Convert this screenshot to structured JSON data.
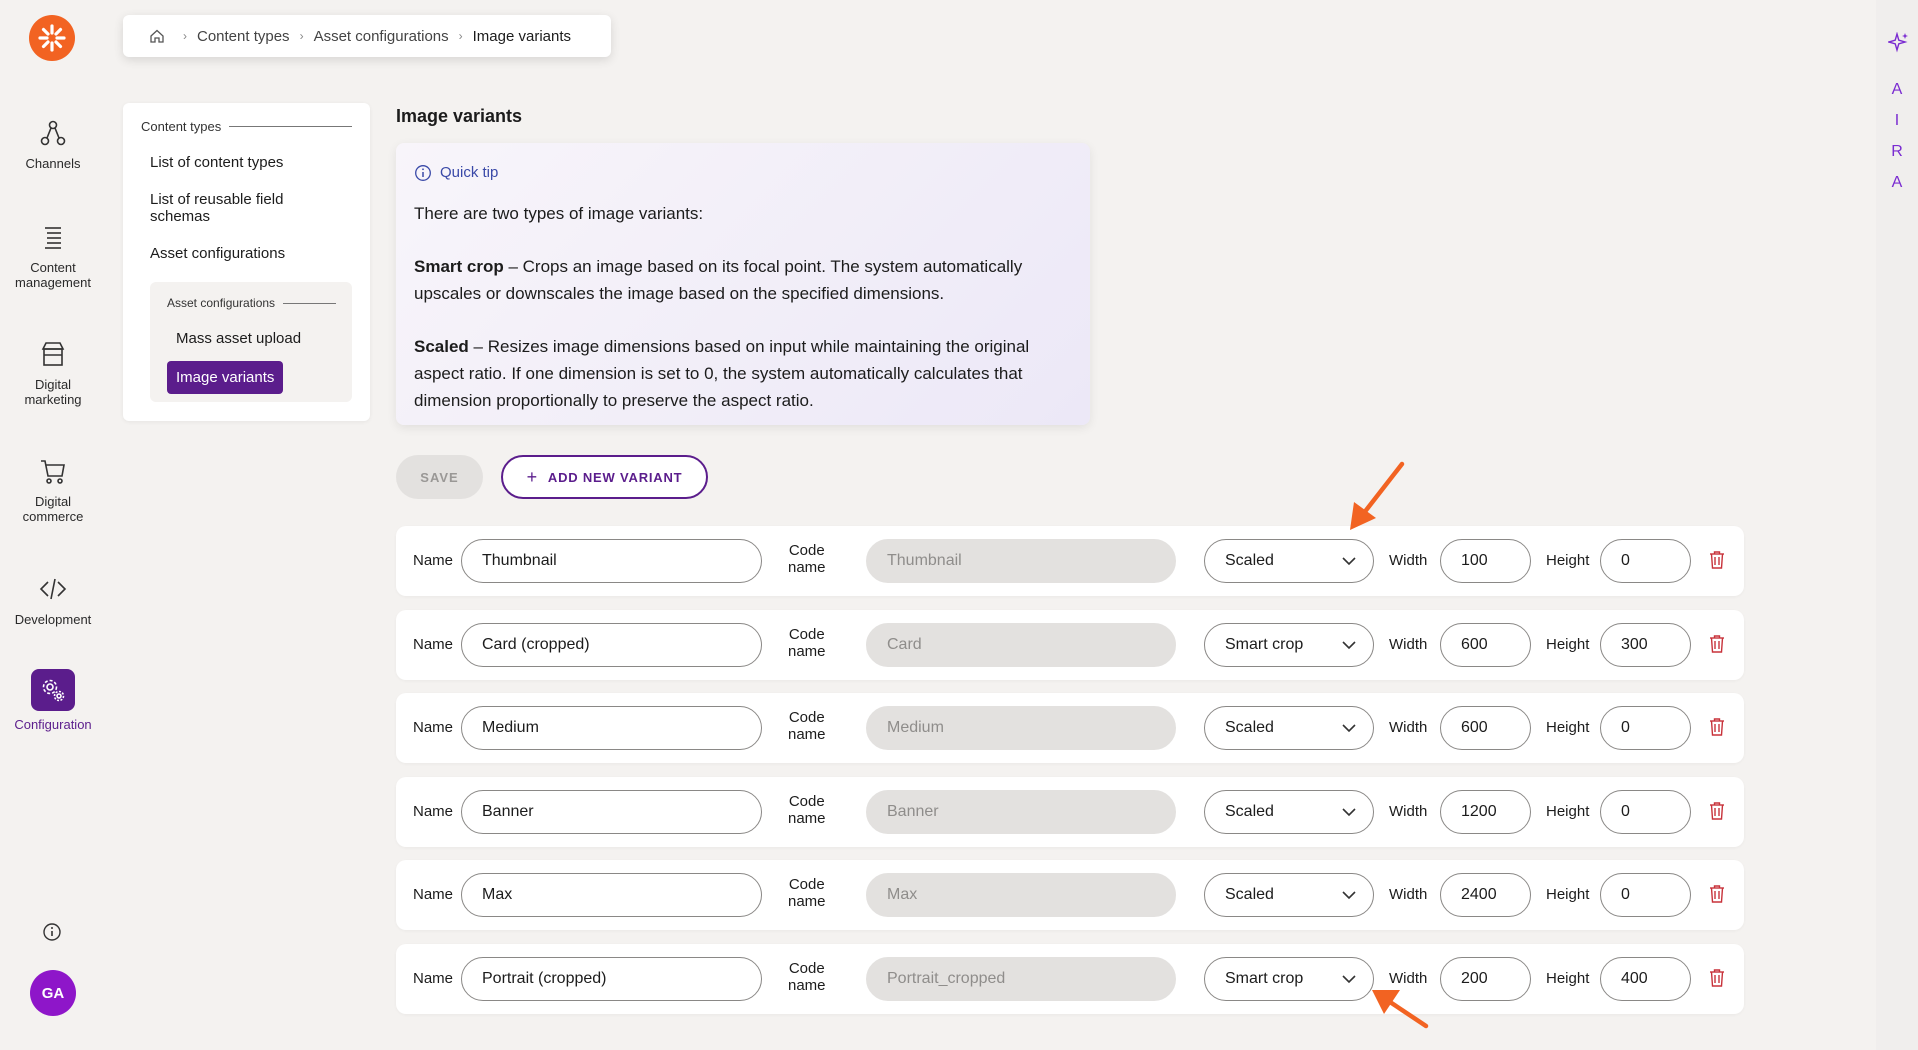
{
  "rail": {
    "items": [
      {
        "label": "Channels",
        "icon": "channels-icon"
      },
      {
        "label": "Content management",
        "icon": "content-management-icon"
      },
      {
        "label": "Digital marketing",
        "icon": "digital-marketing-icon"
      },
      {
        "label": "Digital commerce",
        "icon": "cart-icon"
      },
      {
        "label": "Development",
        "icon": "code-icon"
      },
      {
        "label": "Configuration",
        "icon": "gear-icon"
      }
    ],
    "avatar": "GA"
  },
  "breadcrumb": {
    "items": [
      "Content types",
      "Asset configurations",
      "Image variants"
    ]
  },
  "subnav": {
    "group_title": "Content types",
    "items": [
      "List of content types",
      "List of reusable field schemas",
      "Asset configurations"
    ],
    "nested_title": "Asset configurations",
    "nested_items": [
      "Mass asset upload",
      "Image variants"
    ]
  },
  "main": {
    "title": "Image variants",
    "tip": {
      "heading": "Quick tip",
      "intro": "There are two types of image variants:",
      "smart_crop_term": "Smart crop",
      "smart_crop_text": " – Crops an image based on its focal point. The system automatically upscales or downscales the image based on the specified dimensions.",
      "scaled_term": "Scaled",
      "scaled_text": " – Resizes image dimensions based on input while maintaining the original aspect ratio. If one dimension is set to 0, the system automatically calculates that dimension proportionally to preserve the aspect ratio."
    },
    "save_label": "SAVE",
    "add_label": "ADD NEW VARIANT",
    "labels": {
      "name": "Name",
      "code": "Code",
      "code2": "name",
      "width": "Width",
      "height": "Height"
    },
    "variants": [
      {
        "name": "Thumbnail",
        "code": "Thumbnail",
        "type": "Scaled",
        "width": "100",
        "height": "0"
      },
      {
        "name": "Card (cropped)",
        "code": "Card",
        "type": "Smart crop",
        "width": "600",
        "height": "300"
      },
      {
        "name": "Medium",
        "code": "Medium",
        "type": "Scaled",
        "width": "600",
        "height": "0"
      },
      {
        "name": "Banner",
        "code": "Banner",
        "type": "Scaled",
        "width": "1200",
        "height": "0"
      },
      {
        "name": "Max",
        "code": "Max",
        "type": "Scaled",
        "width": "2400",
        "height": "0"
      },
      {
        "name": "Portrait (cropped)",
        "code": "Portrait_cropped",
        "type": "Smart crop",
        "width": "200",
        "height": "400"
      }
    ]
  },
  "right_rail": {
    "letters": [
      "A",
      "I",
      "R",
      "A"
    ]
  },
  "colors": {
    "brand": "#5b1d8c",
    "logo": "#f26322",
    "accent": "#7a2bd1",
    "annotation": "#f26322"
  }
}
